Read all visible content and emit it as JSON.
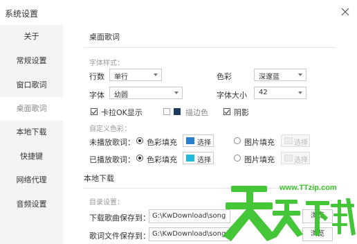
{
  "window": {
    "title": "系统设置"
  },
  "sidebar": {
    "items": [
      {
        "label": "关于"
      },
      {
        "label": "常规设置"
      },
      {
        "label": "窗口歌词"
      },
      {
        "label": "桌面歌词"
      },
      {
        "label": "本地下载"
      },
      {
        "label": "快捷键"
      },
      {
        "label": "网络代理"
      },
      {
        "label": "音频设置"
      }
    ],
    "active_index": 3
  },
  "desktop_lyrics": {
    "heading": "桌面歌词",
    "font_style_label": "字体样式：",
    "rows_label": "行数",
    "rows_value": "单行",
    "color_label": "色彩",
    "color_value": "深邃蓝",
    "font_label": "字体",
    "font_value": "幼圆",
    "font_size_label": "字体大小",
    "font_size_value": "42",
    "karaoke": {
      "label": "卡拉OK显示",
      "checked": true
    },
    "stroke": {
      "label": "描边色",
      "checked": false,
      "swatch": "#1f3a5f"
    },
    "shadow": {
      "label": "阴影",
      "checked": true
    },
    "custom_color_label": "自定义色彩：",
    "unplayed": {
      "label": "未播放歌词：",
      "color_fill_label": "色彩填充",
      "select_label": "选择",
      "swatch": "#2b7fd0",
      "image_fill_label": "图片填充",
      "image_select_label": "选择"
    },
    "played": {
      "label": "已播放歌词：",
      "color_fill_label": "色彩填充",
      "select_label": "选择",
      "swatch": "#22b8e0",
      "image_fill_label": "图片填充",
      "image_select_label": "选择"
    }
  },
  "local_download": {
    "heading": "本地下载",
    "dir_label": "目录设置：",
    "song_label": "下载歌曲保存到：",
    "song_path": "G:\\KwDownload\\song",
    "lyrics_label": "歌词文件保存到：",
    "lyrics_path": "G:\\KwDownload\\song",
    "browse_label": "浏览"
  },
  "watermark": {
    "text": "www.TTzip.com",
    "brand": "天天下载"
  },
  "colors": {
    "accent_green": "#3cc22e",
    "selected_bg": "#ffffff",
    "sidebar_bg": "#f3f4f6"
  }
}
